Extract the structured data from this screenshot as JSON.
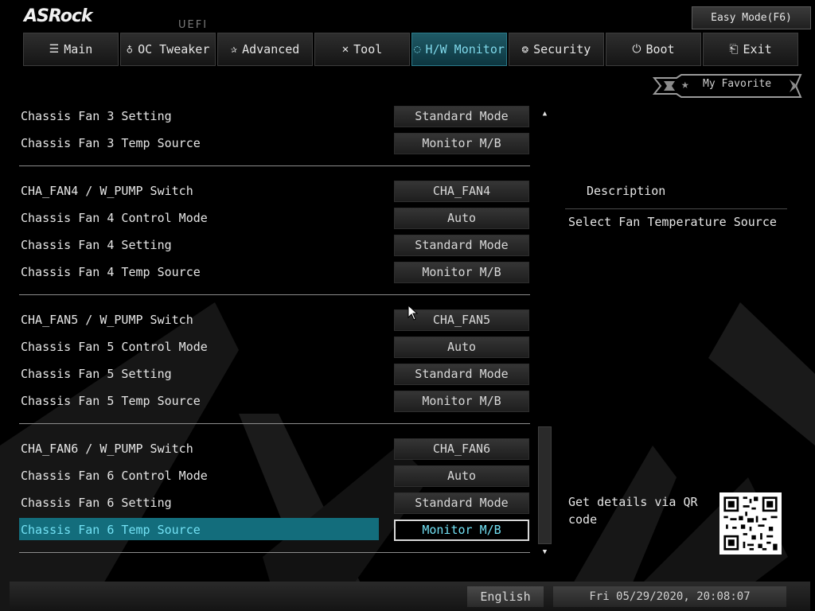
{
  "brand": {
    "logo": "ASRock",
    "subtitle": "UEFI"
  },
  "header": {
    "easy_mode_label": "Easy Mode(F6)"
  },
  "nav": {
    "tabs": [
      {
        "label": "Main",
        "icon": "list-icon",
        "active": false
      },
      {
        "label": "OC Tweaker",
        "icon": "rocket-icon",
        "active": false
      },
      {
        "label": "Advanced",
        "icon": "star-icon",
        "active": false
      },
      {
        "label": "Tool",
        "icon": "tools-icon",
        "active": false
      },
      {
        "label": "H/W Monitor",
        "icon": "monitor-icon",
        "active": true
      },
      {
        "label": "Security",
        "icon": "shield-icon",
        "active": false
      },
      {
        "label": "Boot",
        "icon": "power-icon",
        "active": false
      },
      {
        "label": "Exit",
        "icon": "exit-icon",
        "active": false
      }
    ]
  },
  "favorite": {
    "label": "My Favorite"
  },
  "settings": [
    {
      "label": "Chassis Fan 3 Setting",
      "value": "Standard Mode"
    },
    {
      "label": "Chassis Fan 3 Temp Source",
      "value": "Monitor M/B"
    },
    {
      "label": "CHA_FAN4 / W_PUMP Switch",
      "value": "CHA_FAN4"
    },
    {
      "label": "Chassis Fan 4 Control Mode",
      "value": "Auto"
    },
    {
      "label": "Chassis Fan 4 Setting",
      "value": "Standard Mode"
    },
    {
      "label": "Chassis Fan 4 Temp Source",
      "value": "Monitor M/B"
    },
    {
      "label": "CHA_FAN5 / W_PUMP Switch",
      "value": "CHA_FAN5"
    },
    {
      "label": "Chassis Fan 5 Control Mode",
      "value": "Auto"
    },
    {
      "label": "Chassis Fan 5 Setting",
      "value": "Standard Mode"
    },
    {
      "label": "Chassis Fan 5 Temp Source",
      "value": "Monitor M/B"
    },
    {
      "label": "CHA_FAN6 / W_PUMP Switch",
      "value": "CHA_FAN6"
    },
    {
      "label": "Chassis Fan 6 Control Mode",
      "value": "Auto"
    },
    {
      "label": "Chassis Fan 6 Setting",
      "value": "Standard Mode"
    },
    {
      "label": "Chassis Fan 6 Temp Source",
      "value": "Monitor M/B",
      "selected": true
    }
  ],
  "description": {
    "title": "Description",
    "text": "Select Fan Temperature Source",
    "qr_text": "Get details via QR code"
  },
  "footer": {
    "language": "English",
    "datetime": "Fri 05/29/2020, 20:08:07"
  },
  "colors": {
    "accent": "#136d7c",
    "accent_text": "#72e0f3",
    "background": "#000000"
  }
}
